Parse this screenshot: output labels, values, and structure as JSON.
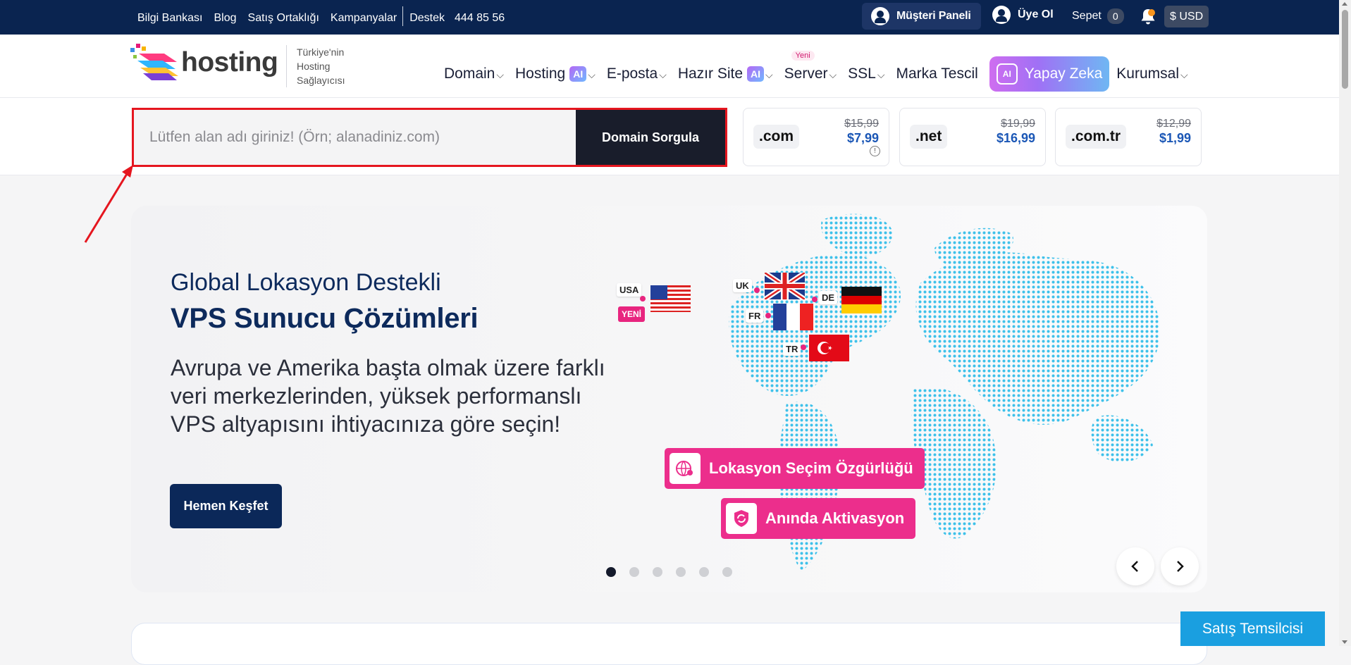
{
  "topbar": {
    "links": [
      "Bilgi Bankası",
      "Blog",
      "Satış Ortaklığı",
      "Kampanyalar"
    ],
    "support_label": "Destek",
    "phone": "444 85 56",
    "panel_label": "Müşteri Paneli",
    "signup_label": "Üye Ol",
    "cart_label": "Sepet",
    "cart_count": "0",
    "currency": "$ USD"
  },
  "nav": {
    "logo_text": "hosting",
    "tagline": [
      "Türkiye'nin",
      "Hosting",
      "Sağlayıcısı"
    ],
    "items": {
      "domain": "Domain",
      "hosting": "Hosting",
      "eposta": "E-posta",
      "hazir_site": "Hazır Site",
      "server": "Server",
      "ssl": "SSL",
      "marka": "Marka Tescil",
      "yapay_zeka": "Yapay Zeka",
      "kurumsal": "Kurumsal"
    },
    "ai_badge": "AI",
    "new_tag": "Yeni",
    "chevron": "⌵"
  },
  "search": {
    "placeholder": "Lütfen alan adı giriniz! (Örn; alanadiniz.com)",
    "button_label": "Domain Sorgula"
  },
  "tlds": [
    {
      "name": ".com",
      "old_price": "$15,99",
      "new_price": "$7,99"
    },
    {
      "name": ".net",
      "old_price": "$19,99",
      "new_price": "$16,99"
    },
    {
      "name": ".com.tr",
      "old_price": "$12,99",
      "new_price": "$1,99"
    }
  ],
  "hero": {
    "subtitle": "Global Lokasyon Destekli",
    "title": "VPS Sunucu Çözümleri",
    "description": "Avrupa ve Amerika başta olmak üzere farklı veri merkezlerinden, yüksek performanslı VPS altyapısını ihtiyacınıza göre seçin!",
    "cta_label": "Hemen Keşfet",
    "features": [
      "Lokasyon Seçim Özgürlüğü",
      "Anında Aktivasyon"
    ],
    "locations": {
      "usa": "USA",
      "uk": "UK",
      "fr": "FR",
      "de": "DE",
      "tr": "TR"
    },
    "new_badge": "YENİ",
    "slide_count": 6,
    "active_slide": 1
  },
  "floating": {
    "sales_label": "Satış Temsilcisi"
  },
  "colors": {
    "topbar_bg": "#0a2450",
    "accent_pink": "#ec2e8c",
    "price_blue": "#1b57b6",
    "highlight_red": "#e5161f",
    "sales_blue": "#1a9fe0"
  }
}
